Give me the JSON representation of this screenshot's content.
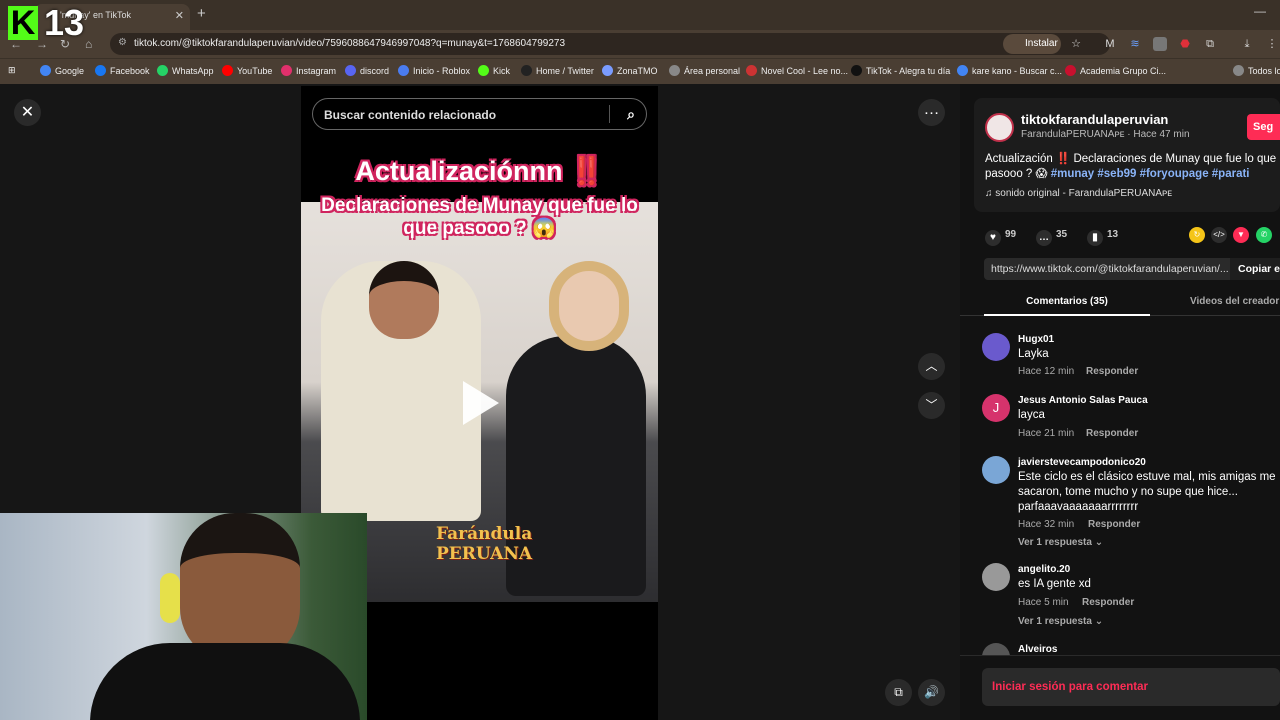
{
  "browser": {
    "tab_title": "'munay' en TikTok",
    "url": "tiktok.com/@tiktokfarandulaperuvian/video/7596088647946997048?q=munay&t=1768604799273",
    "install_label": "Instalar",
    "bookmarks": [
      "Google",
      "Facebook",
      "WhatsApp",
      "YouTube",
      "Instagram",
      "discord",
      "Inicio - Roblox",
      "Kick",
      "Home / Twitter",
      "ZonaTMO",
      "Área personal",
      "Novel Cool - Lee no...",
      "TikTok - Alegra tu día",
      "kare kano - Buscar c...",
      "Academia Grupo Ci...",
      "Todos lo"
    ],
    "bookmark_colors": [
      "#4285f4",
      "#1877f2",
      "#25d366",
      "#ff0000",
      "#e1306c",
      "#5865f2",
      "#4a7cf0",
      "#53fc18",
      "#222222",
      "#7a9cff",
      "#888888",
      "#cc3333",
      "#111111",
      "#4285f4",
      "#c8102e",
      "#888888"
    ]
  },
  "overlay_logo": {
    "letter": "K",
    "number": "13"
  },
  "search": {
    "placeholder": "Buscar contenido relacionado"
  },
  "video": {
    "overlay_title": "Actualizaciónnn ‼️",
    "overlay_subtitle": "Declaraciones de Munay que fue lo que pasooo ? 😱",
    "watermark": "Farándula PERUANA"
  },
  "author": {
    "username": "tiktokfarandulaperuvian",
    "subline": "FarandulaPERUANAᴘᴇ · Hace 47 min",
    "follow_label": "Seg"
  },
  "description": {
    "text": "Actualización ‼️ Declaraciones de Munay que fue lo que pasooo ? 😱",
    "tags": "#munay #seb99 #foryoupage #parati",
    "sound": "♫  sonido original - FarandulaPERUANAᴘᴇ"
  },
  "stats": {
    "likes": "99",
    "comments": "35",
    "saves": "13"
  },
  "link": {
    "url": "https://www.tiktok.com/@tiktokfarandulaperuvian/...",
    "copy_label": "Copiar en"
  },
  "tabs": {
    "comments": "Comentarios (35)",
    "creator_videos": "Videos del creador"
  },
  "comments": [
    {
      "user": "Hugx01",
      "text": "Layka",
      "time": "Hace 12 min",
      "reply": "Responder",
      "color": "#6a5acd"
    },
    {
      "user": "Jesus Antonio Salas Pauca",
      "text": "layca",
      "time": "Hace 21 min",
      "reply": "Responder",
      "color": "#d6336c",
      "initial": "J"
    },
    {
      "user": "javierstevecampodonico20",
      "text": "Este ciclo es el clásico estuve mal, mis amigas me sacaron, tome mucho y no supe que hice... parfaaavaaaaaaarrrrrrrr",
      "time": "Hace 32 min",
      "reply": "Responder",
      "more": "Ver 1 respuesta ⌄",
      "color": "#7aa6d6"
    },
    {
      "user": "angelito.20",
      "text": "es IA gente xd",
      "time": "Hace 5 min",
      "reply": "Responder",
      "more": "Ver 1 respuesta ⌄",
      "color": "#999999"
    },
    {
      "user": "Alveiros",
      "color": "#555555"
    }
  ],
  "login": {
    "label": "Iniciar sesión para comentar"
  }
}
